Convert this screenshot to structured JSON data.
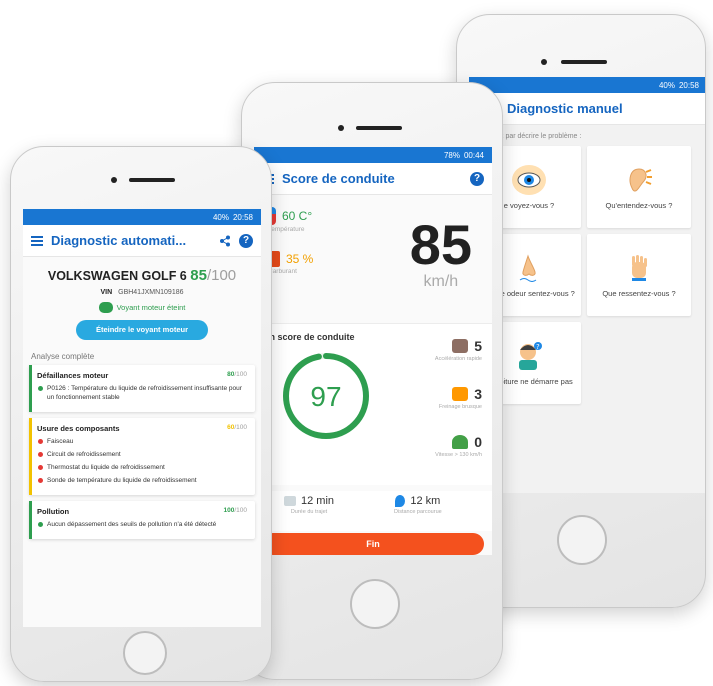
{
  "phone1": {
    "status": "20:58",
    "battery": "40%",
    "title": "Diagnostic automati...",
    "car": {
      "name": "VOLKSWAGEN GOLF 6",
      "score": "85",
      "max": "/100",
      "vin_label": "VIN",
      "vin": "GBH41JXMN109186"
    },
    "voyant": "Voyant moteur éteint",
    "button": "Éteindre le voyant moteur",
    "analyse_title": "Analyse complète",
    "cards": [
      {
        "title": "Défaillances moteur",
        "score": "80",
        "max": "/100",
        "color": "#2e9e4f",
        "items": [
          "P0126 : Température du liquide de refroidissement insuffisante pour un fonctionnement stable"
        ]
      },
      {
        "title": "Usure des composants",
        "score": "60",
        "max": "/100",
        "color": "#f2c200",
        "items": [
          "Faisceau",
          "Circuit de refroidissement",
          "Thermostat du liquide de refroidissement",
          "Sonde de température du liquide de refroidissement"
        ]
      },
      {
        "title": "Pollution",
        "score": "100",
        "max": "/100",
        "color": "#2e9e4f",
        "items": [
          "Aucun dépassement des seuils de pollution n'a été détecté"
        ]
      }
    ]
  },
  "phone2": {
    "status": "00:44",
    "battery": "78%",
    "title": "Score de conduite",
    "temperature": {
      "value": "60 C°",
      "label": "Température"
    },
    "fuel": {
      "value": "35 %",
      "label": "Carburant"
    },
    "speed": {
      "value": "85",
      "unit": "km/h"
    },
    "score_label": "on score de conduite",
    "score": {
      "value": "97",
      "fraction": 0.97
    },
    "stats": [
      {
        "value": "5",
        "caption": "Accélération rapide"
      },
      {
        "value": "3",
        "caption": "Freinage brusque"
      },
      {
        "value": "0",
        "caption": "Vitesse > 130 km/h"
      }
    ],
    "trip": [
      {
        "value": "12 min",
        "caption": "Durée du trajet"
      },
      {
        "value": "12 km",
        "caption": "Distance parcourue"
      }
    ],
    "button": "Fin"
  },
  "phone3": {
    "status": "20:58",
    "battery": "40%",
    "title": "Diagnostic manuel",
    "intro": "mencez par décrire le problème :",
    "tiles": [
      {
        "label": "e voyez-vous ?",
        "icon": "eye-icon",
        "color": "#ffe0b2"
      },
      {
        "label": "Qu'entendez-vous ?",
        "icon": "ear-icon",
        "color": "#ffe0b2"
      },
      {
        "label": "Quelle odeur sentez-vous ?",
        "icon": "nose-icon",
        "color": "#ffe0b2"
      },
      {
        "label": "Que ressentez-vous ?",
        "icon": "hand-icon",
        "color": "#ffe0b2"
      },
      {
        "label": "La voiture ne démarre pas",
        "icon": "driver-icon",
        "color": "#ffe0b2"
      }
    ]
  }
}
